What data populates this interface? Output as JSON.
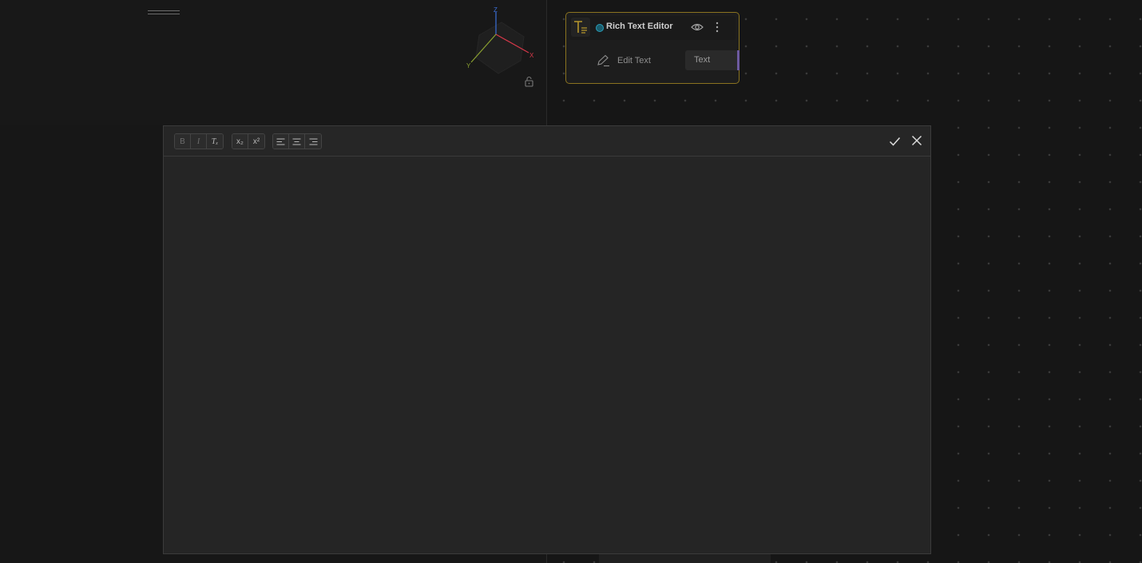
{
  "viewport": {
    "gizmo_axes": {
      "z": "Z",
      "x": "X",
      "y": "Y"
    },
    "axis_colors": {
      "z": "#3a6fd8",
      "x": "#d8384a",
      "y": "#8aa030"
    }
  },
  "node": {
    "title": "Rich Text Editor",
    "edit_label": "Edit Text",
    "output_label": "Text",
    "accent_color": "#8a7320",
    "status_color": "#2a9db8",
    "icons": {
      "type": "text-format-icon",
      "visibility": "eye-icon",
      "menu": "kebab-icon",
      "edit": "pencil-icon"
    }
  },
  "editor": {
    "toolbar": {
      "format_group": [
        {
          "name": "bold",
          "label": "B"
        },
        {
          "name": "italic",
          "label": "I"
        },
        {
          "name": "clear-format",
          "label": "Tₓ"
        }
      ],
      "script_group": [
        {
          "name": "subscript",
          "label": "x₂"
        },
        {
          "name": "superscript",
          "label": "x²"
        }
      ],
      "align_group": [
        {
          "name": "align-left",
          "icon": "align-left-icon"
        },
        {
          "name": "align-center",
          "icon": "align-center-icon"
        },
        {
          "name": "align-right",
          "icon": "align-right-icon"
        }
      ]
    },
    "content": "",
    "actions": {
      "confirm": "check-icon",
      "close": "close-icon"
    }
  }
}
